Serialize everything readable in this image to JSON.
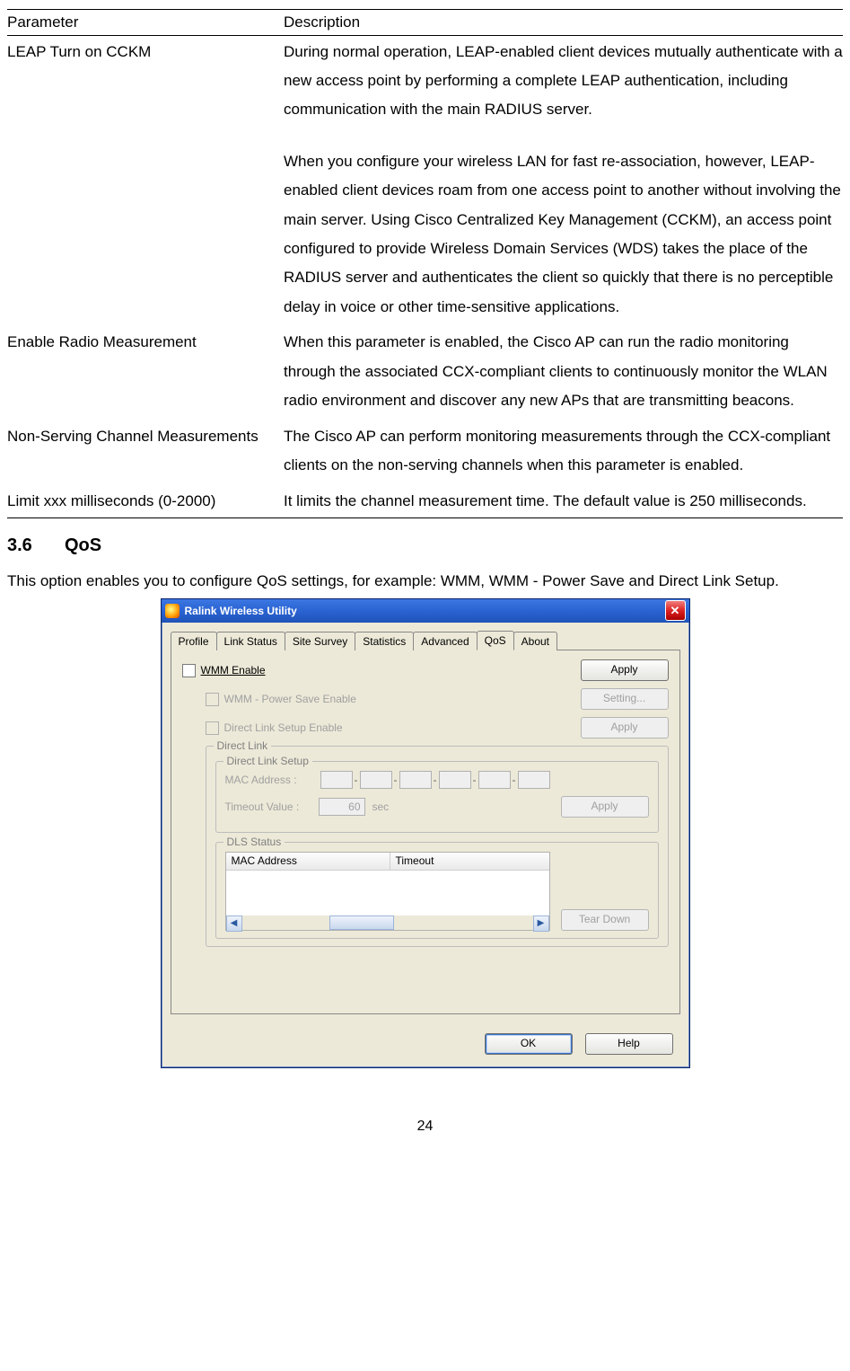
{
  "table": {
    "header_param": "Parameter",
    "header_desc": "Description",
    "rows": [
      {
        "param": "LEAP Turn on CCKM",
        "desc": [
          "During normal operation, LEAP-enabled client devices mutually authenticate with a new access point by performing a complete LEAP authentication, including communication with the main RADIUS server.",
          "When you configure your wireless LAN for fast re-association, however, LEAP-enabled client devices roam from one access point to another without involving the main server. Using Cisco Centralized Key Management (CCKM), an access point configured to provide Wireless Domain Services (WDS) takes the place of the RADIUS server and authenticates the client so quickly that there is no perceptible delay in voice or other time-sensitive applications."
        ]
      },
      {
        "param": "Enable Radio Measurement",
        "desc": [
          "When this parameter is enabled, the Cisco AP can run the radio monitoring through the associated CCX-compliant clients to continuously monitor the WLAN radio environment and discover any new APs that are transmitting beacons."
        ]
      },
      {
        "param": "Non-Serving Channel Measurements",
        "desc": [
          "The Cisco AP can perform monitoring measurements through the CCX-compliant clients on the non-serving channels when this parameter is enabled."
        ]
      },
      {
        "param": "Limit xxx milliseconds (0-2000)",
        "desc_justify": "It limits the channel measurement time. The default value is 250 milliseconds."
      }
    ]
  },
  "section": {
    "num": "3.6",
    "title": "QoS"
  },
  "intro": "This option enables you to configure QoS settings, for example: WMM, WMM - Power Save and Direct Link Setup.",
  "dialog": {
    "title": "Ralink Wireless Utility",
    "tabs": [
      "Profile",
      "Link Status",
      "Site Survey",
      "Statistics",
      "Advanced",
      "QoS",
      "About"
    ],
    "active_tab": "QoS",
    "wmm_enable": "WMM Enable",
    "wmm_ps": "WMM - Power Save Enable",
    "dls_enable": "Direct Link Setup Enable",
    "btn_apply": "Apply",
    "btn_setting": "Setting...",
    "grp_direct_link": "Direct Link",
    "grp_direct_link_setup": "Direct Link Setup",
    "mac_label": "MAC Address :",
    "timeout_label": "Timeout Value :",
    "timeout_value": "60",
    "timeout_unit": "sec",
    "grp_dls_status": "DLS Status",
    "col_mac": "MAC Address",
    "col_timeout": "Timeout",
    "btn_teardown": "Tear Down",
    "btn_ok": "OK",
    "btn_help": "Help"
  },
  "page_number": "24"
}
